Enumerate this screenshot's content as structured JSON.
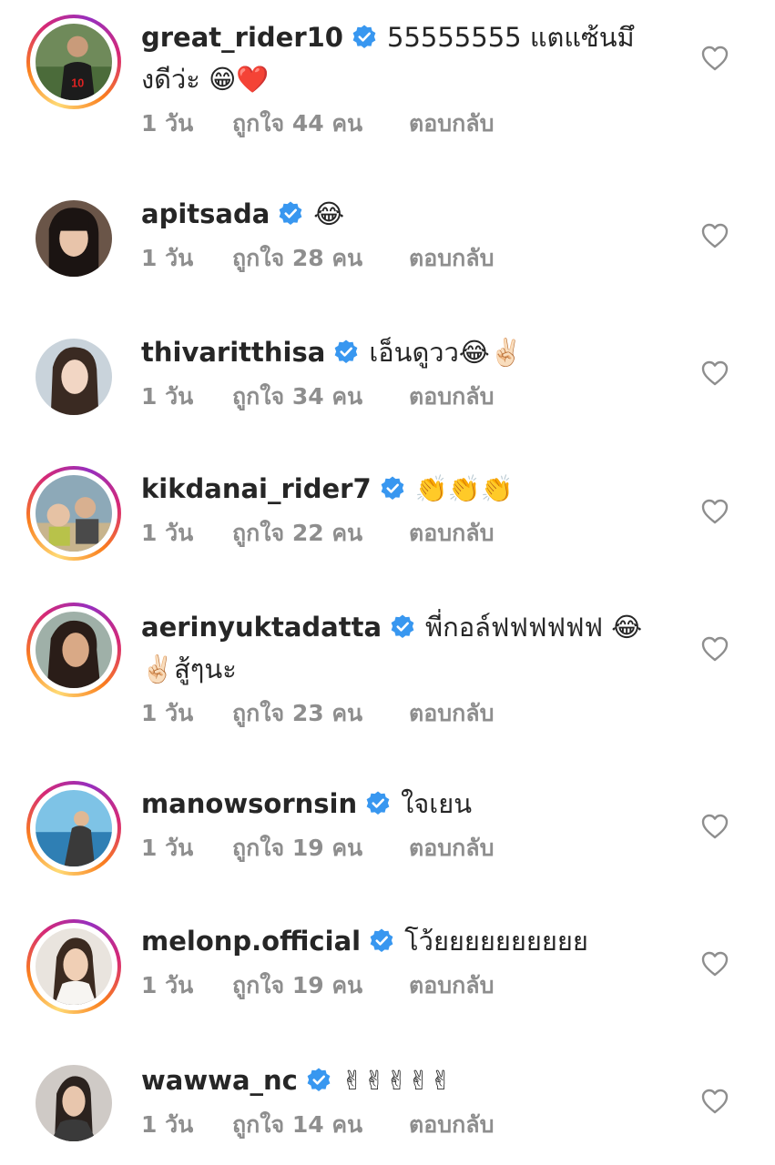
{
  "comments": [
    {
      "username": "great_rider10",
      "text": "55555555 แตแซ้นมึงดีว่ะ 😁❤️",
      "time": "1 วัน",
      "likes": "ถูกใจ 44 คน",
      "reply": "ตอบกลับ",
      "story_ring": true
    },
    {
      "username": "apitsada",
      "text": "😂",
      "time": "1 วัน",
      "likes": "ถูกใจ 28 คน",
      "reply": "ตอบกลับ",
      "story_ring": false
    },
    {
      "username": "thivaritthisa",
      "text": "เอ็นดูวว😂✌🏻",
      "time": "1 วัน",
      "likes": "ถูกใจ 34 คน",
      "reply": "ตอบกลับ",
      "story_ring": false
    },
    {
      "username": "kikdanai_rider7",
      "text": "👏👏👏",
      "time": "1 วัน",
      "likes": "ถูกใจ 22 คน",
      "reply": "ตอบกลับ",
      "story_ring": true
    },
    {
      "username": "aerinyuktadatta",
      "text": "พี่กอล์ฟฟฟฟฟฟ 😂 ✌🏻สู้ๆนะ",
      "time": "1 วัน",
      "likes": "ถูกใจ 23 คน",
      "reply": "ตอบกลับ",
      "story_ring": true
    },
    {
      "username": "manowsornsin",
      "text": "ใจเยน",
      "time": "1 วัน",
      "likes": "ถูกใจ 19 คน",
      "reply": "ตอบกลับ",
      "story_ring": true
    },
    {
      "username": "melonp.official",
      "text": "โว้ยยยยยยยยยย",
      "time": "1 วัน",
      "likes": "ถูกใจ 19 คน",
      "reply": "ตอบกลับ",
      "story_ring": true
    },
    {
      "username": "wawwa_nc",
      "text": "✌✌✌✌✌",
      "time": "1 วัน",
      "likes": "ถูกใจ 14 คน",
      "reply": "ตอบกลับ",
      "story_ring": false
    }
  ],
  "colors": {
    "verified_badge": "#3897f0",
    "meta_text": "#8e8e8e",
    "primary_text": "#262626",
    "heart_outline": "#8e8e8e"
  },
  "icons": {
    "verified": "verified-badge-icon",
    "like": "heart-outline-icon"
  }
}
